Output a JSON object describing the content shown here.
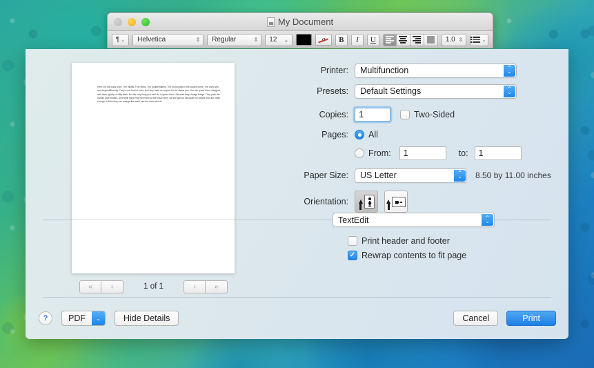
{
  "window": {
    "title": "My Document",
    "traffic_lights": [
      "close",
      "minimize",
      "maximize"
    ],
    "toolbar": {
      "paragraph_style": "¶",
      "font_family": "Helvetica",
      "font_style": "Regular",
      "font_size": "12",
      "bold": "B",
      "italic": "I",
      "underline": "U",
      "line_spacing": "1.0"
    }
  },
  "preview": {
    "body": "Here's to the crazy ones. The misfits. The rebels. The troublemakers. The round pegs in the square holes. The ones who see things differently. They're not fond of rules. And they have no respect for the status quo. You can quote them, disagree with them, glorify or vilify them. But the only thing you can't do is ignore them. Because they change things. They push the human race forward. And while some may see them as the crazy ones, we see genius. Because the people who are crazy enough to think they can change the world, are the ones who do.",
    "page_count": "1 of 1",
    "nav_first": "«",
    "nav_prev": "‹",
    "nav_next": "›",
    "nav_last": "»"
  },
  "settings": {
    "printer_label": "Printer:",
    "printer_value": "Multifunction",
    "presets_label": "Presets:",
    "presets_value": "Default Settings",
    "copies_label": "Copies:",
    "copies_value": "1",
    "two_sided_label": "Two-Sided",
    "two_sided_checked": false,
    "pages_label": "Pages:",
    "pages_all_label": "All",
    "pages_all_selected": true,
    "pages_from_label": "From:",
    "pages_from_value": "1",
    "pages_to_label": "to:",
    "pages_to_value": "1",
    "paper_size_label": "Paper Size:",
    "paper_size_value": "US Letter",
    "paper_dimensions": "8.50 by 11.00 inches",
    "orientation_label": "Orientation:",
    "orientation_selected": "portrait",
    "app_pane_value": "TextEdit",
    "print_header_footer_label": "Print header and footer",
    "print_header_footer_checked": false,
    "rewrap_label": "Rewrap contents to fit page",
    "rewrap_checked": true
  },
  "actions": {
    "help": "?",
    "pdf": "PDF",
    "hide_details": "Hide Details",
    "cancel": "Cancel",
    "print": "Print"
  },
  "colors": {
    "accent_blue": "#1b7fe6",
    "sheet_bg": "#dde8ec",
    "desktop_green": "#6cc457",
    "desktop_blue": "#1a6bb5"
  }
}
